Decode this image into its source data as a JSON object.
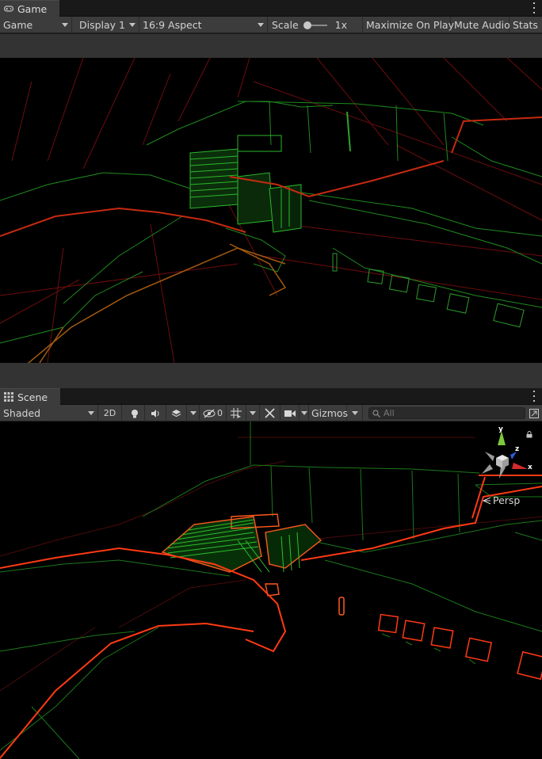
{
  "game_tab": {
    "title": "Game"
  },
  "game_toolbar": {
    "view_mode": "Game",
    "display": "Display 1",
    "aspect": "16:9 Aspect",
    "scale_label": "Scale",
    "scale_value": "1x",
    "maximize": "Maximize On Play",
    "mute": "Mute Audio",
    "stats": "Stats"
  },
  "scene_tab": {
    "title": "Scene"
  },
  "scene_toolbar": {
    "draw_mode": "Shaded",
    "mode_2d": "2D",
    "hidden_count": "0",
    "gizmos": "Gizmos",
    "search_placeholder": "All"
  },
  "orientation_gizmo": {
    "axis_y": "y",
    "axis_z": "z",
    "axis_x": "x",
    "projection": "Persp",
    "axis_colors": {
      "x": "#d22b2b",
      "y": "#7ec83a",
      "z": "#2c5ed8"
    }
  },
  "colors": {
    "panel": "#3c3c3c",
    "tabbar": "#191919",
    "wire_green": "#1f8f1f",
    "wire_red": "#a31414",
    "wire_orange": "#ff4a1a"
  }
}
